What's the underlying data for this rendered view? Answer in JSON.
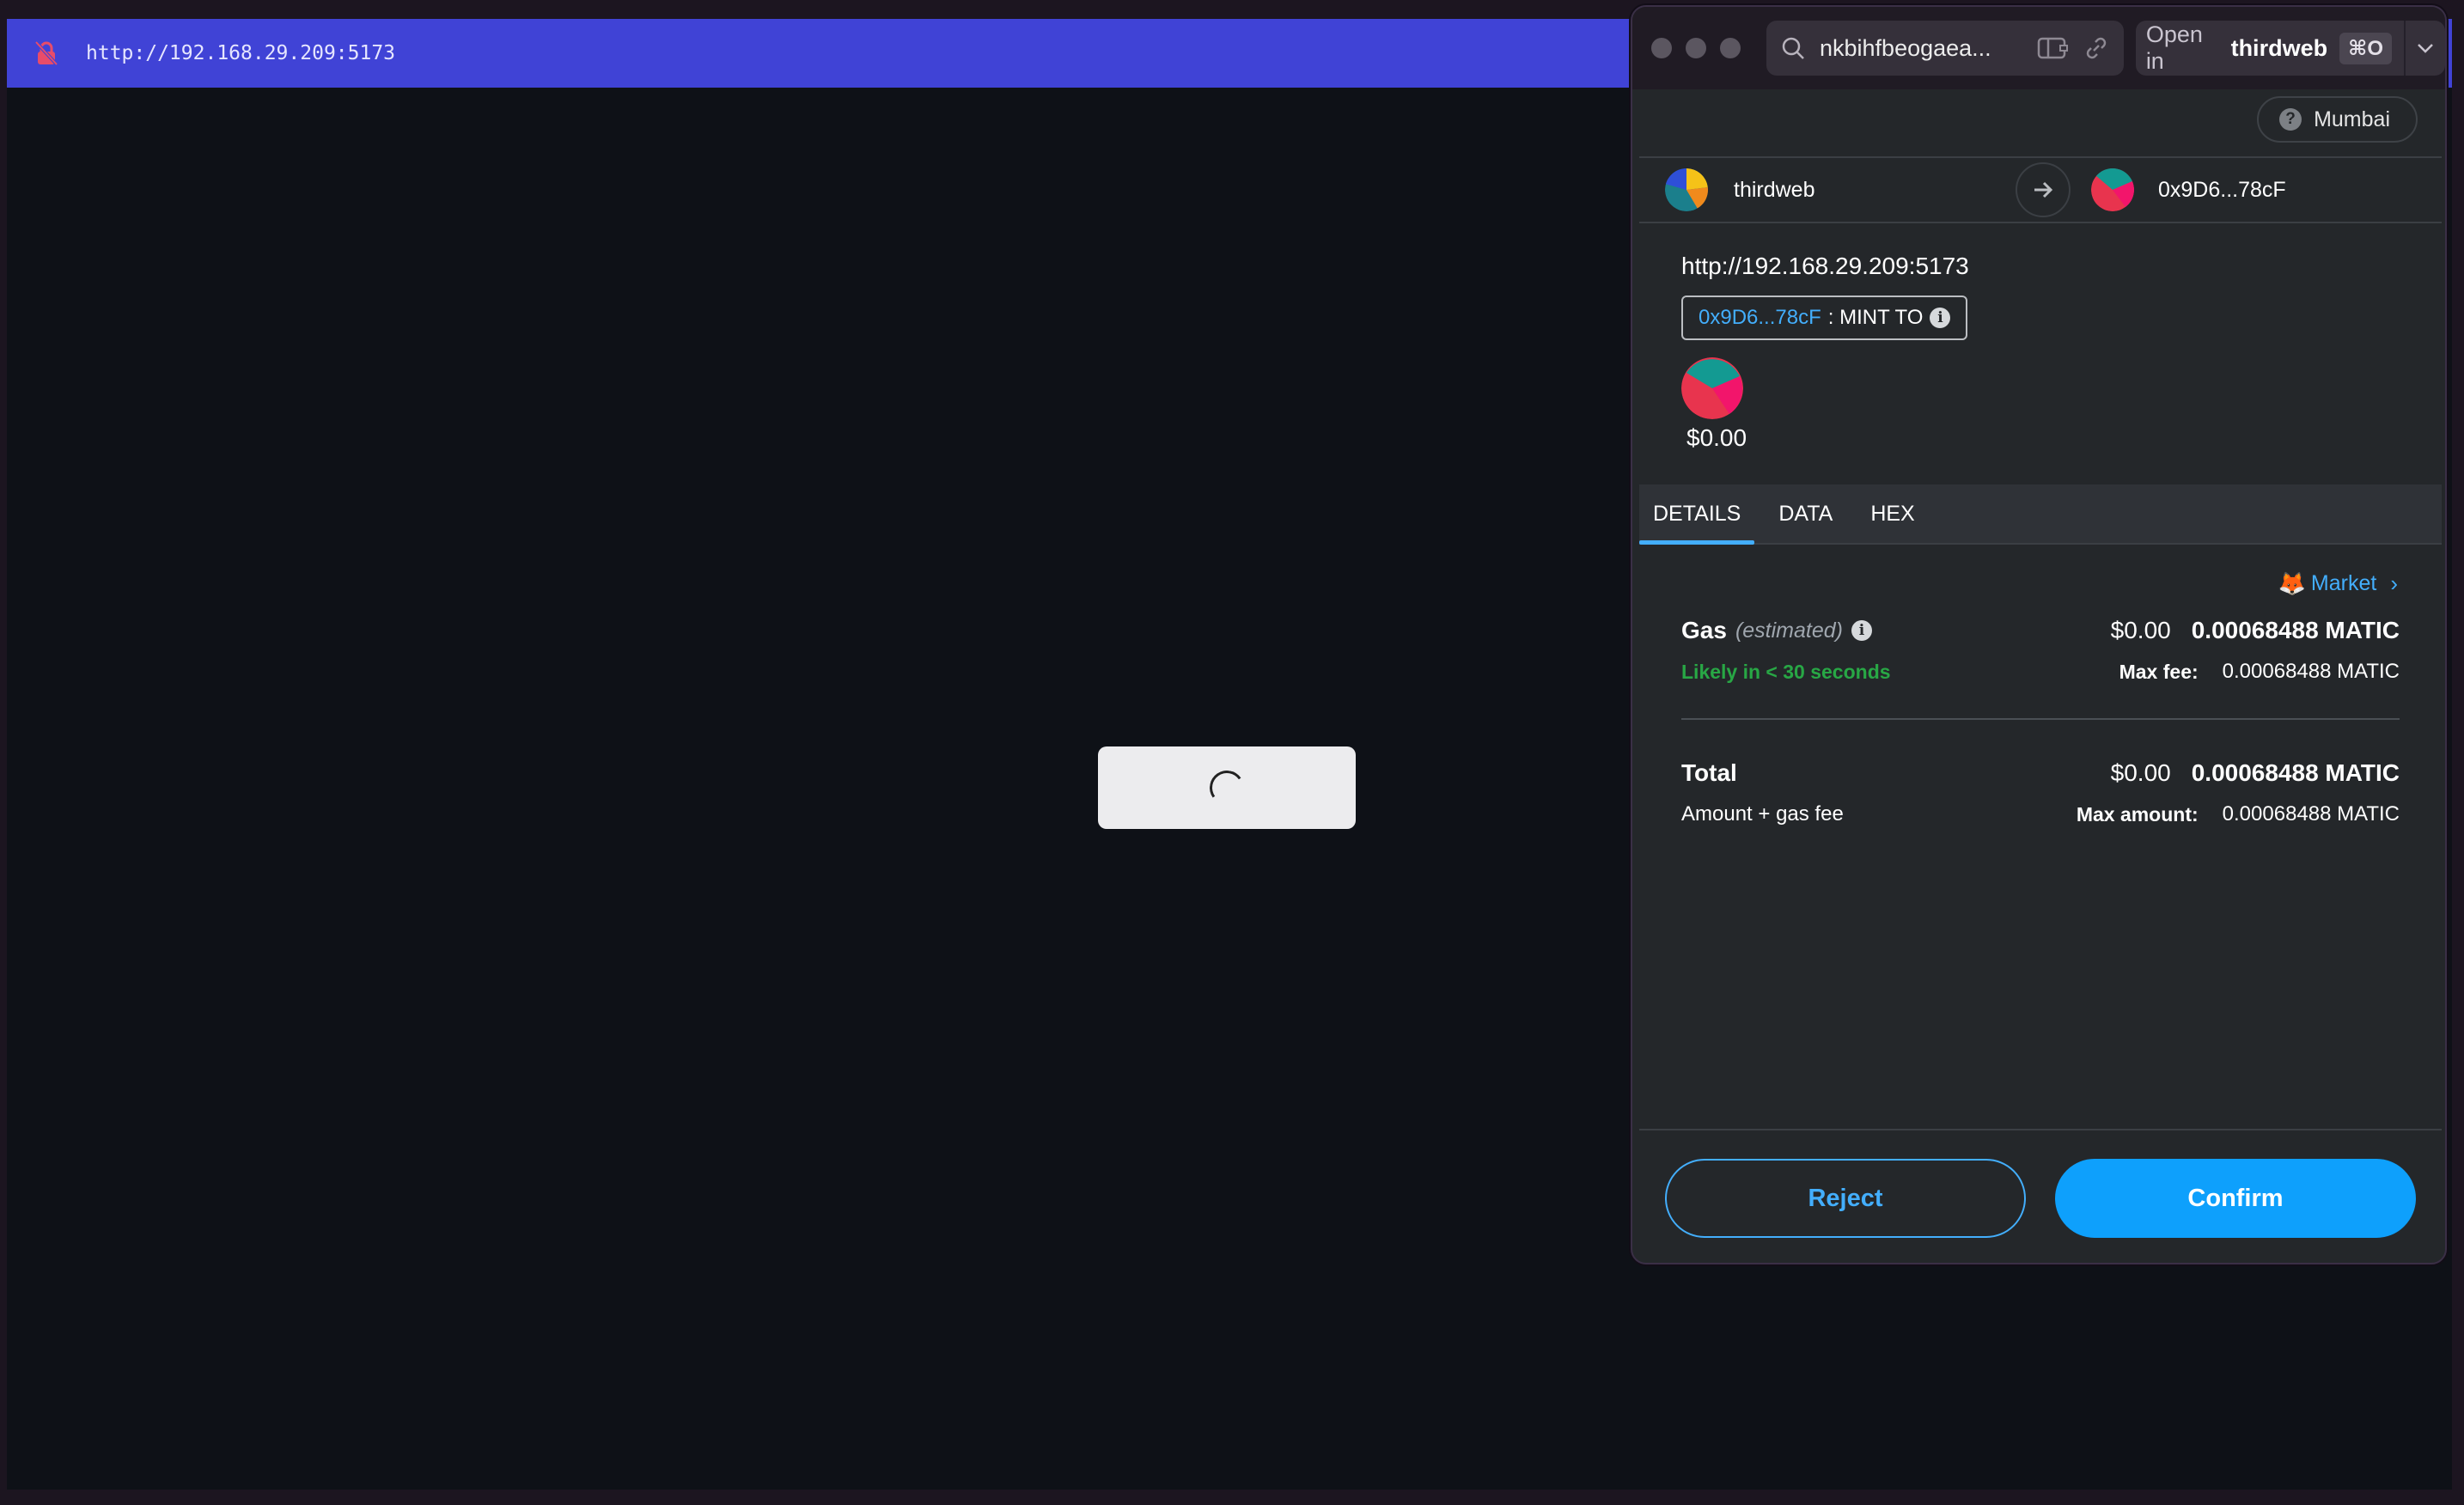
{
  "page": {
    "url": "http://192.168.29.209:5173"
  },
  "popup": {
    "address": "nkbihfbeogaea...",
    "open_in_label": "Open in",
    "open_in_app": "thirdweb",
    "shortcut": "⌘O",
    "network": "Mumbai",
    "network_icon_glyph": "?",
    "sender": "thirdweb",
    "recipient": "0x9D6...78cF",
    "origin": "http://192.168.29.209:5173",
    "method_address": "0x9D6...78cF",
    "method_name": ": MINT TO",
    "amount_usd": "$0.00",
    "tabs": [
      "DETAILS",
      "DATA",
      "HEX"
    ],
    "market_label": "Market",
    "market_icon": "🦊",
    "gas": {
      "label": "Gas",
      "estimated": "(estimated)",
      "usd": "$0.00",
      "matic": "0.00068488 MATIC",
      "likely": "Likely in < 30 seconds",
      "max_fee_label": "Max fee:",
      "max_fee_value": "0.00068488 MATIC"
    },
    "total": {
      "label": "Total",
      "usd": "$0.00",
      "matic": "0.00068488 MATIC",
      "sub": "Amount + gas fee",
      "max_amount_label": "Max amount:",
      "max_amount_value": "0.00068488 MATIC"
    },
    "reject_label": "Reject",
    "confirm_label": "Confirm"
  },
  "colors": {
    "url_bar": "#4043d6",
    "accent_blue": "#43aefc",
    "confirm_bg": "#0ea0fc",
    "success_green": "#28a745",
    "page_bg": "#0e1117",
    "popup_bg": "#24272a"
  }
}
